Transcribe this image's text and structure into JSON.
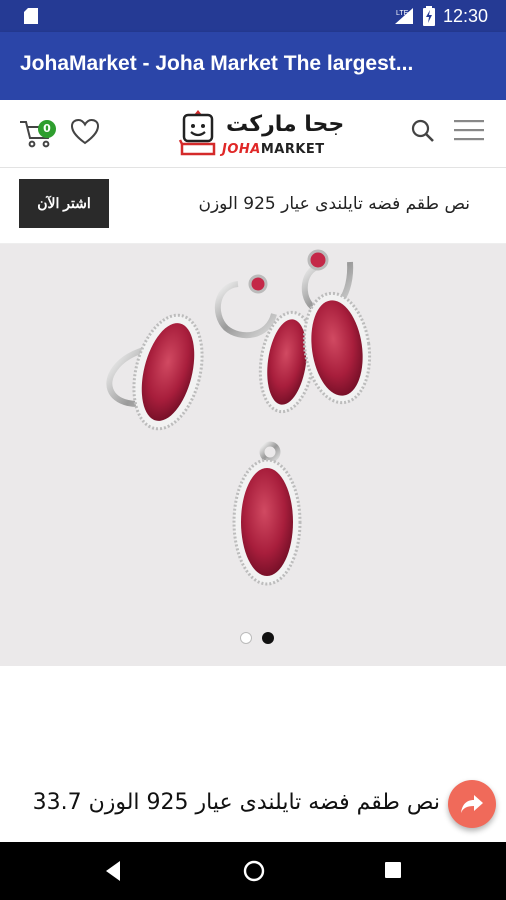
{
  "status_bar": {
    "time": "12:30",
    "network_label": "LTE",
    "icons": [
      "sd-card-icon",
      "signal-icon",
      "battery-charging-icon"
    ]
  },
  "app_bar": {
    "title": "JohaMarket - Joha Market The largest..."
  },
  "header": {
    "cart_count": "0",
    "logo_ar": "جحا ماركت",
    "logo_en_joha": "JOHA",
    "logo_en_market": "MARKET",
    "icons": [
      "cart-icon",
      "heart-icon",
      "search-icon",
      "menu-icon"
    ]
  },
  "promo": {
    "button_label": "اشتر الآن",
    "text": "نص طقم فضه تايلندى عيار 925 الوزن"
  },
  "gallery": {
    "background": "#ebe9ea",
    "slide_count": 2,
    "active_slide": 2
  },
  "product": {
    "title": "نص طقم فضه تايلندى عيار 925 الوزن 33.7"
  },
  "colors": {
    "status_bar": "#253a94",
    "app_bar": "#2b45a8",
    "fab": "#f06a5a",
    "cart_badge": "#2e9e2e",
    "logo_red": "#e02828"
  }
}
